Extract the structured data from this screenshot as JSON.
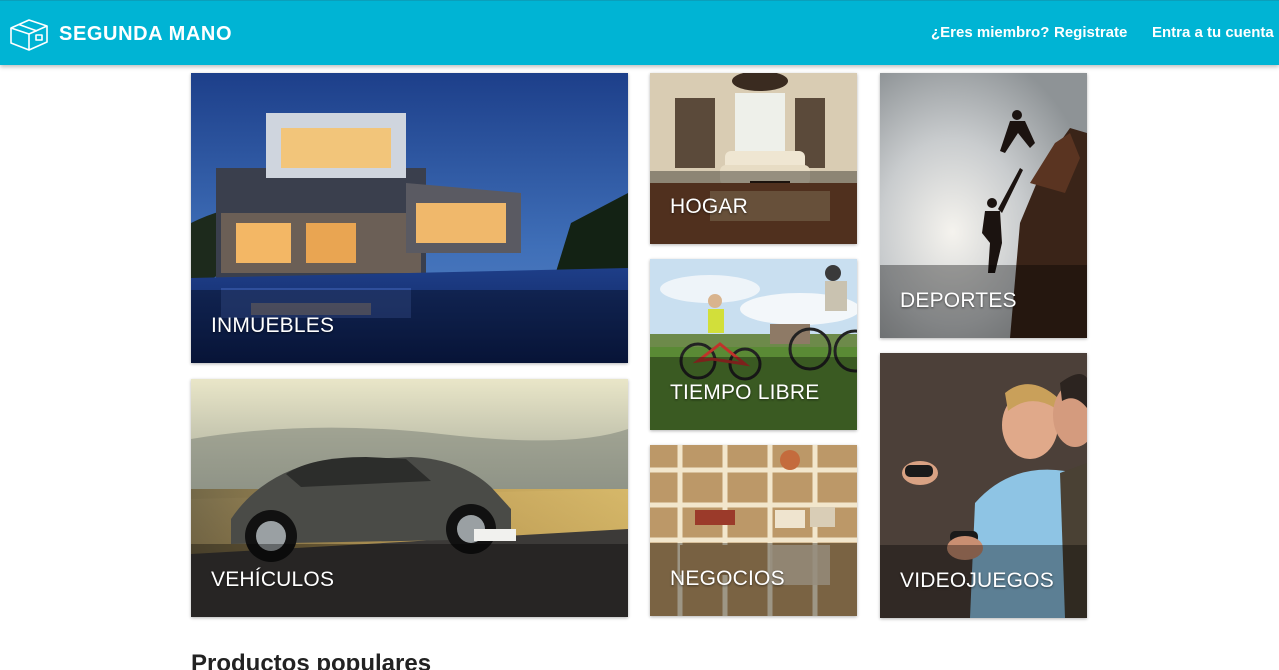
{
  "header": {
    "brand": "SEGUNDA MANO",
    "logo_icon": "box-icon",
    "member_question": "¿Eres miembro?",
    "register": "Registrate",
    "login": "Entra a tu cuenta",
    "color": "#00b4d4"
  },
  "categories": [
    {
      "id": "inmuebles",
      "label": "INMUEBLES"
    },
    {
      "id": "hogar",
      "label": "HOGAR"
    },
    {
      "id": "deportes",
      "label": "DEPORTES"
    },
    {
      "id": "tiempo-libre",
      "label": "TIEMPO LIBRE"
    },
    {
      "id": "vehiculos",
      "label": "VEHÍCULOS"
    },
    {
      "id": "negocios",
      "label": "NEGOCIOS"
    },
    {
      "id": "videojuegos",
      "label": "VIDEOJUEGOS"
    }
  ],
  "popular": {
    "title": "Productos populares"
  }
}
